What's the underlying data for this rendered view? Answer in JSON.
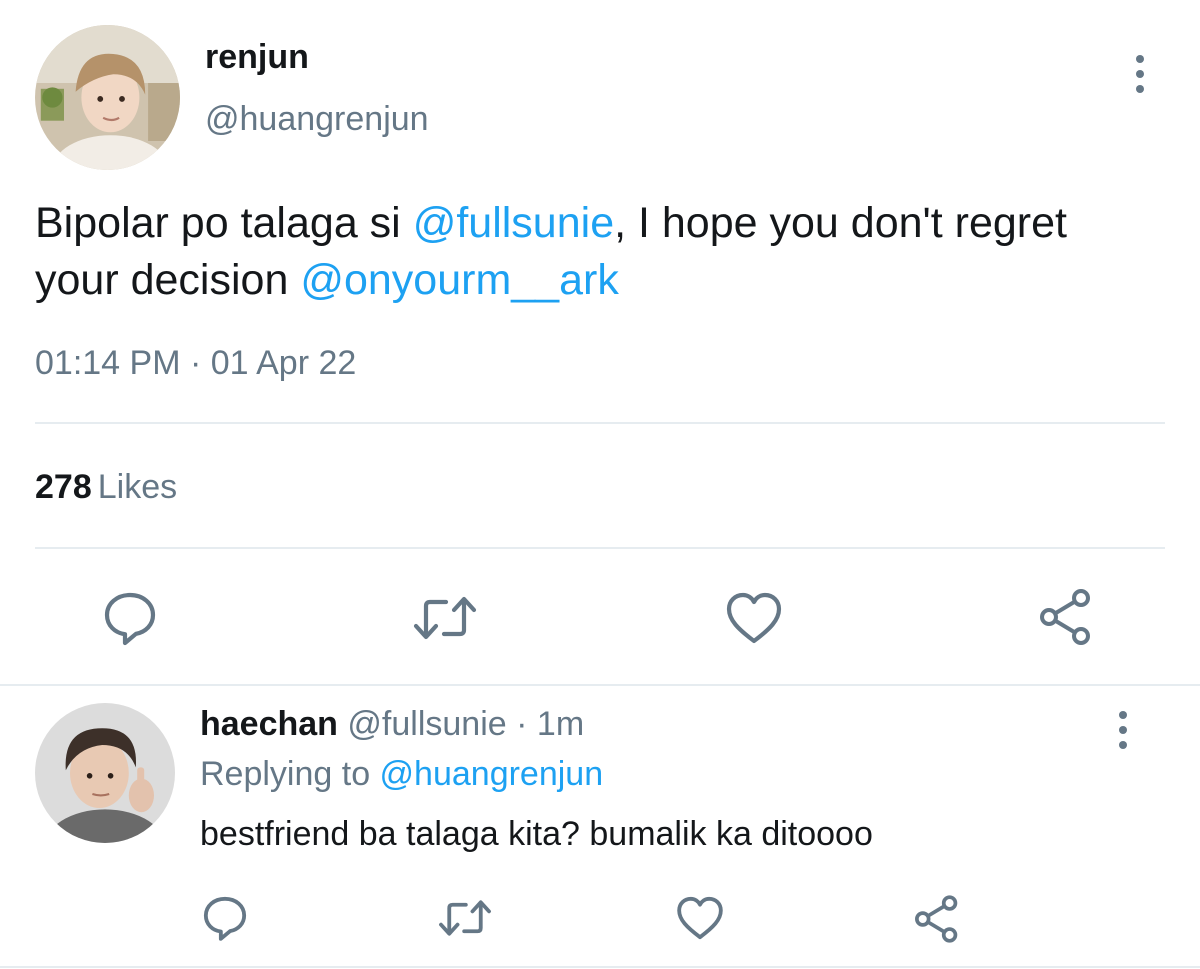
{
  "tweet": {
    "author_name": "renjun",
    "author_handle": "@huangrenjun",
    "text_part1": "Bipolar po talaga si ",
    "mention1": "@fullsunie",
    "text_part2": ", I hope you don't regret your decision ",
    "mention2": "@onyourm__ark",
    "timestamp": "01:14 PM · 01 Apr 22",
    "likes_count": "278",
    "likes_label": "Likes",
    "avatar": "renjun-profile-photo"
  },
  "reply": {
    "author_name": "haechan",
    "author_handle": "@fullsunie",
    "separator": "·",
    "time": "1m",
    "replying_prefix": "Replying to ",
    "replying_handle": "@huangrenjun",
    "text": "bestfriend ba talaga kita? bumalik ka ditoooo",
    "avatar": "haechan-profile-photo"
  },
  "icons": {
    "reply": "reply-icon",
    "retweet": "retweet-icon",
    "like": "heart-icon",
    "share": "share-icon",
    "more": "more-vertical-icon"
  },
  "colors": {
    "link": "#1da1f2",
    "muted": "#657786",
    "text": "#14171a",
    "divider": "#e6ecf0"
  }
}
